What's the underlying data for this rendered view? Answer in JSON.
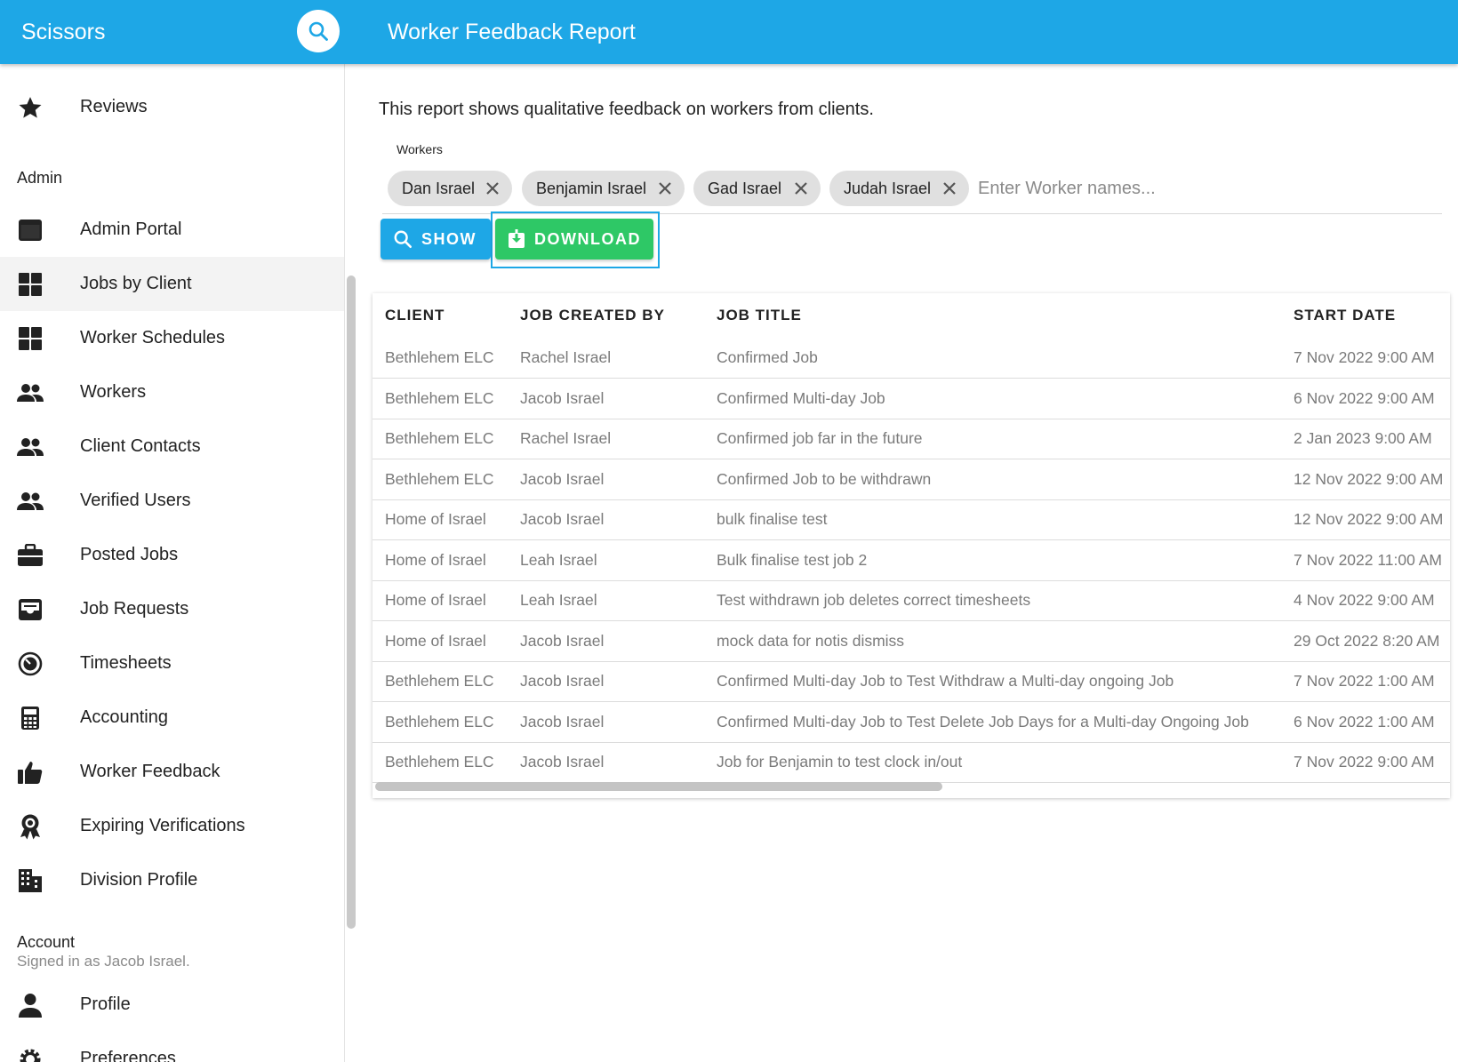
{
  "app": {
    "brand": "Scissors",
    "page_title": "Worker Feedback Report"
  },
  "sidebar": {
    "top_item": {
      "label": "Reviews",
      "icon": "star-icon"
    },
    "admin_section": "Admin",
    "admin_items": [
      {
        "label": "Admin Portal",
        "icon": "window-icon"
      },
      {
        "label": "Jobs by Client",
        "icon": "grid-icon",
        "active": true
      },
      {
        "label": "Worker Schedules",
        "icon": "grid-icon"
      },
      {
        "label": "Workers",
        "icon": "people-icon"
      },
      {
        "label": "Client Contacts",
        "icon": "people-icon"
      },
      {
        "label": "Verified Users",
        "icon": "people-icon"
      },
      {
        "label": "Posted Jobs",
        "icon": "briefcase-icon"
      },
      {
        "label": "Job Requests",
        "icon": "inbox-icon"
      },
      {
        "label": "Timesheets",
        "icon": "timer-icon"
      },
      {
        "label": "Accounting",
        "icon": "calculator-icon"
      },
      {
        "label": "Worker Feedback",
        "icon": "thumbs-up-icon"
      },
      {
        "label": "Expiring Verifications",
        "icon": "badge-icon"
      },
      {
        "label": "Division Profile",
        "icon": "building-icon"
      }
    ],
    "account_section": "Account",
    "signed_in": "Signed in as Jacob Israel.",
    "account_items": [
      {
        "label": "Profile",
        "icon": "person-icon"
      },
      {
        "label": "Preferences",
        "icon": "gear-icon"
      }
    ]
  },
  "main": {
    "description": "This report shows qualitative feedback on workers from clients.",
    "workers_label": "Workers",
    "chips": [
      "Dan Israel",
      "Benjamin Israel",
      "Gad Israel",
      "Judah Israel"
    ],
    "worker_input_placeholder": "Enter Worker names...",
    "show_label": "SHOW",
    "download_label": "DOWNLOAD"
  },
  "table": {
    "headers": [
      "CLIENT",
      "JOB CREATED BY",
      "JOB TITLE",
      "START DATE"
    ],
    "rows": [
      [
        "Bethlehem ELC",
        "Rachel Israel",
        "Confirmed Job",
        "7 Nov 2022 9:00 AM"
      ],
      [
        "Bethlehem ELC",
        "Jacob Israel",
        "Confirmed Multi-day Job",
        "6 Nov 2022 9:00 AM"
      ],
      [
        "Bethlehem ELC",
        "Rachel Israel",
        "Confirmed job far in the future",
        "2 Jan 2023 9:00 AM"
      ],
      [
        "Bethlehem ELC",
        "Jacob Israel",
        "Confirmed Job to be withdrawn",
        "12 Nov 2022 9:00 AM"
      ],
      [
        "Home of Israel",
        "Jacob Israel",
        "bulk finalise test",
        "12 Nov 2022 9:00 AM"
      ],
      [
        "Home of Israel",
        "Leah Israel",
        "Bulk finalise test job 2",
        "7 Nov 2022 11:00 AM"
      ],
      [
        "Home of Israel",
        "Leah Israel",
        "Test withdrawn job deletes correct timesheets",
        "4 Nov 2022 9:00 AM"
      ],
      [
        "Home of Israel",
        "Jacob Israel",
        "mock data for notis dismiss",
        "29 Oct 2022 8:20 AM"
      ],
      [
        "Bethlehem ELC",
        "Jacob Israel",
        "Confirmed Multi-day Job to Test Withdraw a Multi-day ongoing Job",
        "7 Nov 2022 1:00 AM"
      ],
      [
        "Bethlehem ELC",
        "Jacob Israel",
        "Confirmed Multi-day Job to Test Delete Job Days for a Multi-day Ongoing Job",
        "6 Nov 2022 1:00 AM"
      ],
      [
        "Bethlehem ELC",
        "Jacob Israel",
        "Job for Benjamin to test clock in/out",
        "7 Nov 2022 9:00 AM"
      ]
    ]
  },
  "colors": {
    "primary": "#1ea7e6",
    "download": "#2ec866"
  }
}
